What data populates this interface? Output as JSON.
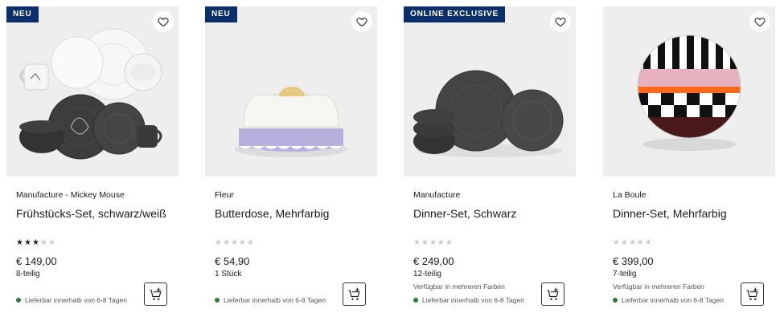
{
  "products": [
    {
      "badge": "NEU",
      "brand": "Manufacture - Mickey Mouse",
      "title": "Frühstücks-Set, schwarz/weiß",
      "rating": 3,
      "rating_max": 5,
      "price": "€ 149,00",
      "pieces": "8-teilig",
      "variants": "",
      "delivery": "Lieferbar innerhalb von 6-8 Tagen",
      "image_icon": "breakfast-set-image"
    },
    {
      "badge": "NEU",
      "brand": "Fleur",
      "title": "Butterdose, Mehrfarbig",
      "rating": 0,
      "rating_max": 5,
      "price": "€ 54,90",
      "pieces": "1 Stück",
      "variants": "",
      "delivery": "Lieferbar innerhalb von 6-8 Tagen",
      "image_icon": "butter-dish-image"
    },
    {
      "badge": "ONLINE EXCLUSIVE",
      "brand": "Manufacture",
      "title": "Dinner-Set, Schwarz",
      "rating": 0,
      "rating_max": 5,
      "price": "€ 249,00",
      "pieces": "12-teilig",
      "variants": "Verfügbar in mehreren Farben",
      "delivery": "Lieferbar innerhalb von 6-8 Tagen",
      "image_icon": "dinner-set-image"
    },
    {
      "badge": "",
      "brand": "La Boule",
      "title": "Dinner-Set, Mehrfarbig",
      "rating": 0,
      "rating_max": 5,
      "price": "€ 399,00",
      "pieces": "7-teilig",
      "variants": "Verfügbar in mehreren Farben",
      "delivery": "Lieferbar innerhalb von 6-8 Tagen",
      "image_icon": "la-boule-image"
    }
  ],
  "icons": {
    "favorite": "heart-icon",
    "cart": "add-to-cart-icon",
    "availability": "availability-dot-icon",
    "rating": "star-icon"
  },
  "colors": {
    "badge_bg": "#0b2f6b",
    "image_bg": "#eeeeee",
    "available": "#2d7a3a",
    "star_on": "#222222",
    "star_off": "#c8c8c8"
  }
}
